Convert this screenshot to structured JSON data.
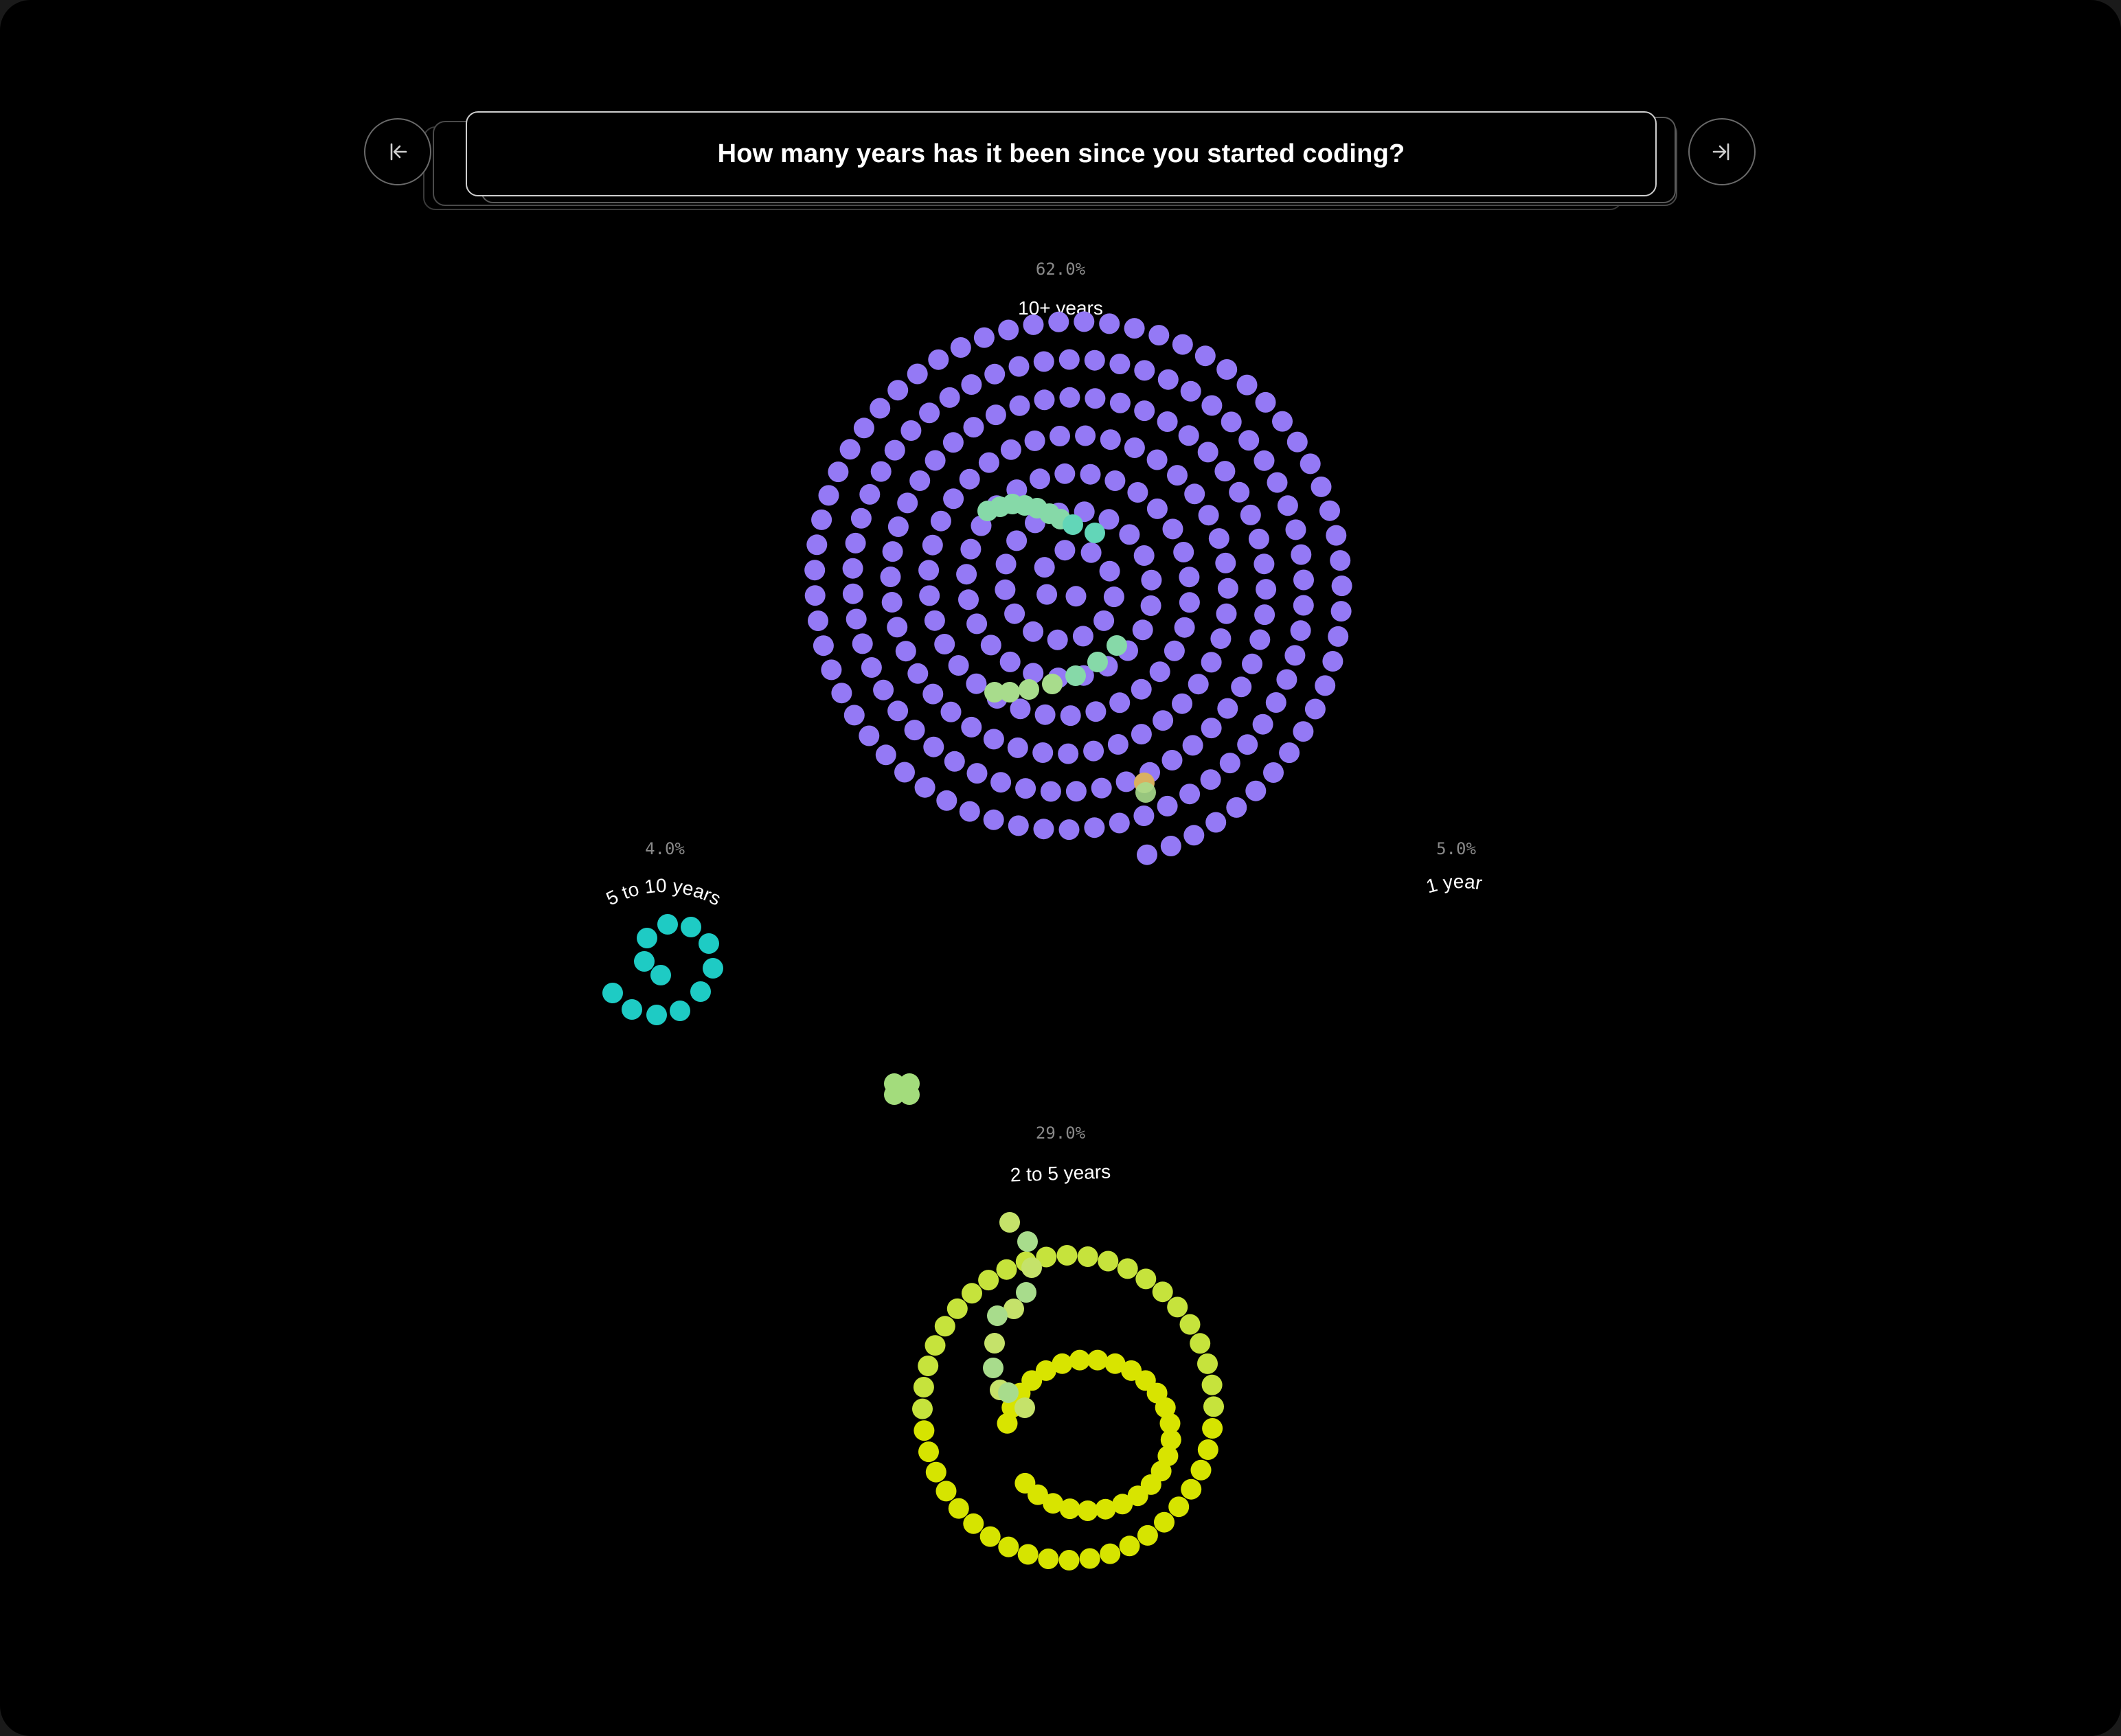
{
  "question": {
    "title": "How many years has it been since you started coding?"
  },
  "navigation": {
    "prev_icon": "arrow-left-to-bar-icon",
    "next_icon": "arrow-right-to-bar-icon"
  },
  "chart_data": {
    "type": "spiral-dot-cluster",
    "title": "How many years has it been since you started coding?",
    "unit": "percent of respondents",
    "series": [
      {
        "label": "10+ years",
        "percent_label": "62.0%",
        "value": 62.0,
        "color": "#9479f5"
      },
      {
        "label": "5 to 10 years",
        "percent_label": "4.0%",
        "value": 4.0,
        "color": "#1ecbc4"
      },
      {
        "label": "1 year",
        "percent_label": "5.0%",
        "value": 5.0,
        "color": "#a3dc7c"
      },
      {
        "label": "2 to 5 years",
        "percent_label": "29.0%",
        "value": 29.0,
        "color": "#cde31a"
      }
    ],
    "transition_colors": [
      "#86d9a8",
      "#a8dc8c",
      "#c5e26a"
    ]
  }
}
